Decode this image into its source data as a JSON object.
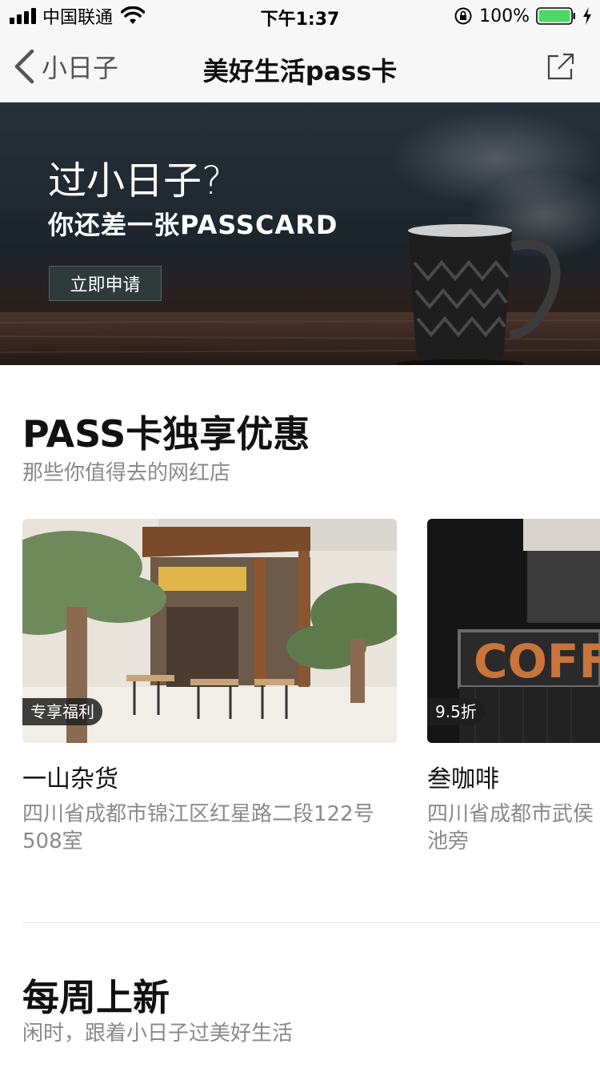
{
  "status_bar": {
    "carrier": "中国联通",
    "time": "下午1:37",
    "battery_percent": "100%",
    "battery_level": 1.0,
    "battery_color": "#4cd964"
  },
  "nav": {
    "back_label": "小日子",
    "title": "美好生活pass卡"
  },
  "banner": {
    "tagline": "过小日子?",
    "subtitle": "你还差一张PASSCARD",
    "apply_button": "立即申请"
  },
  "section_offers": {
    "title": "PASS卡独享优惠",
    "subtitle": "那些你值得去的网红店",
    "cards": [
      {
        "badge": "专享福利",
        "name": "一山杂货",
        "address": "四川省成都市锦江区红星路二段122号508室"
      },
      {
        "badge": "9.5折",
        "name": "叁咖啡",
        "address": "四川省成都市武侯池旁"
      }
    ]
  },
  "section_weekly": {
    "title": "每周上新",
    "subtitle": "闲时，跟着小日子过美好生活"
  }
}
